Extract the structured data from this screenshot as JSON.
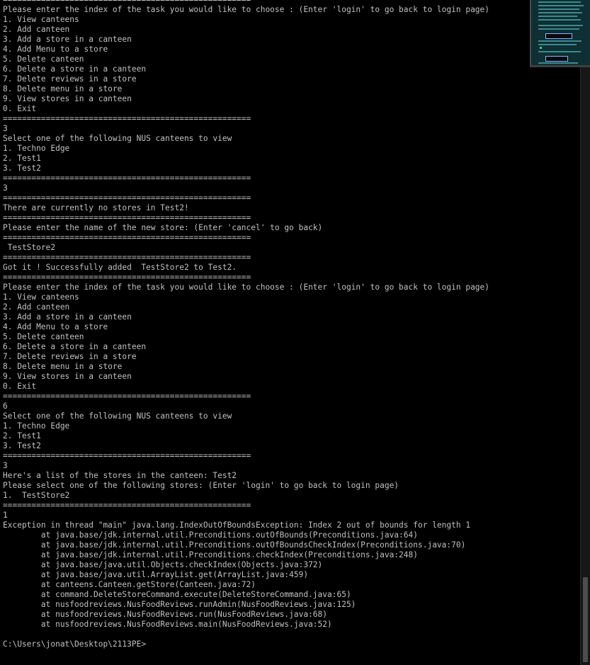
{
  "console": {
    "lines": [
      "====================================================",
      "Please enter the index of the task you would like to choose : (Enter 'login' to go back to login page)",
      "1. View canteens",
      "2. Add canteen",
      "3. Add a store in a canteen",
      "4. Add Menu to a store",
      "5. Delete canteen",
      "6. Delete a store in a canteen",
      "7. Delete reviews in a store",
      "8. Delete menu in a store",
      "9. View stores in a canteen",
      "0. Exit",
      "====================================================",
      "3",
      "Select one of the following NUS canteens to view",
      "1. Techno Edge",
      "2. Test1",
      "3. Test2",
      "====================================================",
      "3",
      "====================================================",
      "There are currently no stores in Test2!",
      "====================================================",
      "Please enter the name of the new store: (Enter 'cancel' to go back)",
      "====================================================",
      " TestStore2",
      "====================================================",
      "Got it ! Successfully added  TestStore2 to Test2.",
      "====================================================",
      "Please enter the index of the task you would like to choose : (Enter 'login' to go back to login page)",
      "1. View canteens",
      "2. Add canteen",
      "3. Add a store in a canteen",
      "4. Add Menu to a store",
      "5. Delete canteen",
      "6. Delete a store in a canteen",
      "7. Delete reviews in a store",
      "8. Delete menu in a store",
      "9. View stores in a canteen",
      "0. Exit",
      "====================================================",
      "6",
      "Select one of the following NUS canteens to view",
      "1. Techno Edge",
      "2. Test1",
      "3. Test2",
      "====================================================",
      "3",
      "Here's a list of the stores in the canteen: Test2",
      "Please select one of the following stores: (Enter 'login' to go back to login page)",
      "1.  TestStore2",
      "====================================================",
      "1",
      "Exception in thread \"main\" java.lang.IndexOutOfBoundsException: Index 2 out of bounds for length 1",
      "        at java.base/jdk.internal.util.Preconditions.outOfBounds(Preconditions.java:64)",
      "        at java.base/jdk.internal.util.Preconditions.outOfBoundsCheckIndex(Preconditions.java:70)",
      "        at java.base/jdk.internal.util.Preconditions.checkIndex(Preconditions.java:248)",
      "        at java.base/java.util.Objects.checkIndex(Objects.java:372)",
      "        at java.base/java.util.ArrayList.get(ArrayList.java:459)",
      "        at canteens.Canteen.getStore(Canteen.java:72)",
      "        at command.DeleteStoreCommand.execute(DeleteStoreCommand.java:65)",
      "        at nusfoodreviews.NusFoodReviews.runAdmin(NusFoodReviews.java:125)",
      "        at nusfoodreviews.NusFoodReviews.run(NusFoodReviews.java:68)",
      "        at nusfoodreviews.NusFoodReviews.main(NusFoodReviews.java:52)",
      "",
      "C:\\Users\\jonat\\Desktop\\2113PE>"
    ]
  },
  "colors": {
    "background": "#000000",
    "text": "#c0c0c0",
    "scrollbar": "#171717"
  },
  "icons": {
    "thumbnail": "overlapping-window-thumbnail"
  }
}
